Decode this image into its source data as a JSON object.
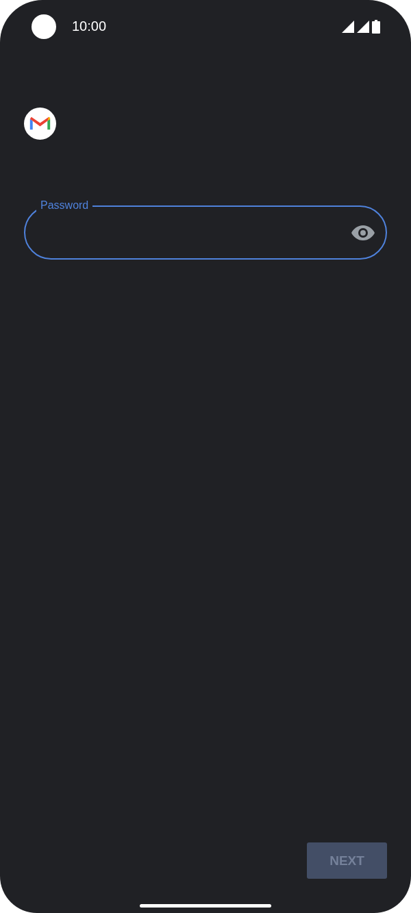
{
  "status_bar": {
    "time": "10:00"
  },
  "password_field": {
    "label": "Password",
    "focused": true
  },
  "buttons": [
    {
      "label": "NEXT",
      "disabled": true
    }
  ]
}
